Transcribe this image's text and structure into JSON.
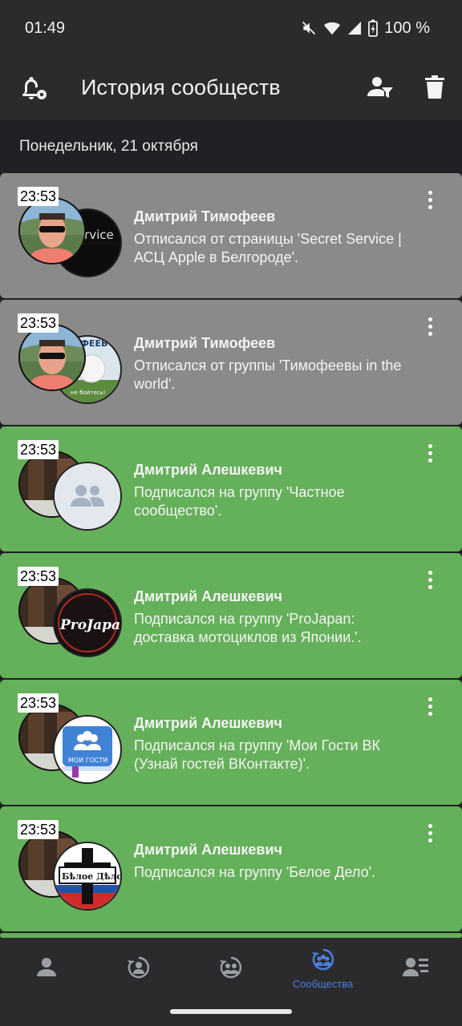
{
  "status": {
    "time": "01:49",
    "battery": "100 %",
    "icons": [
      "mute-icon",
      "wifi-icon",
      "signal-icon",
      "battery-icon"
    ]
  },
  "appbar": {
    "title": "История сообществ",
    "icons": [
      "notification-settings-icon",
      "user-filter-icon",
      "trash-icon"
    ]
  },
  "date_header": "Понедельник, 21 октября",
  "colors": {
    "unsubscribed_bg": "#8a8a8a",
    "subscribed_bg": "#65b05a",
    "accent": "#4a7fe0"
  },
  "events": [
    {
      "time": "23:53",
      "name": "Дмитрий Тимофеев",
      "desc": "Отписался от страницы 'Secret Service | АСЦ Apple в Белгороде'.",
      "type": "unsub",
      "group_icon": "secret-service-logo"
    },
    {
      "time": "23:53",
      "name": "Дмитрий Тимофеев",
      "desc": "Отписался от группы 'Тимофеевы in the world'.",
      "type": "unsub",
      "group_icon": "golf-ball-logo"
    },
    {
      "time": "23:53",
      "name": "Дмитрий Алешкевич",
      "desc": "Подписался на группу 'Частное сообщество'.",
      "type": "sub",
      "group_icon": "default-community-icon"
    },
    {
      "time": "23:53",
      "name": "Дмитрий Алешкевич",
      "desc": "Подписался на группу 'ProJapan: доставка мотоциклов из Японии.'.",
      "type": "sub",
      "group_icon": "projapan-logo",
      "logo_text": "ProJapan"
    },
    {
      "time": "23:53",
      "name": "Дмитрий Алешкевич",
      "desc": "Подписался на группу 'Мои Гости ВК (Узнай гостей ВКонтакте)'.",
      "type": "sub",
      "group_icon": "moi-gosti-logo",
      "logo_text": "МОИ ГОСТИ"
    },
    {
      "time": "23:53",
      "name": "Дмитрий Алешкевич",
      "desc": "Подписался на группу 'Белое Дело'.",
      "type": "sub",
      "group_icon": "beloe-delo-logo",
      "logo_text": "Бѣлое Дѣло"
    }
  ],
  "bottom_nav": [
    {
      "icon": "profile-icon",
      "label": ""
    },
    {
      "icon": "friends-history-icon",
      "label": ""
    },
    {
      "icon": "groups-history-icon",
      "label": ""
    },
    {
      "icon": "communities-icon",
      "label": "Сообщества",
      "active": true
    },
    {
      "icon": "user-list-icon",
      "label": ""
    }
  ]
}
